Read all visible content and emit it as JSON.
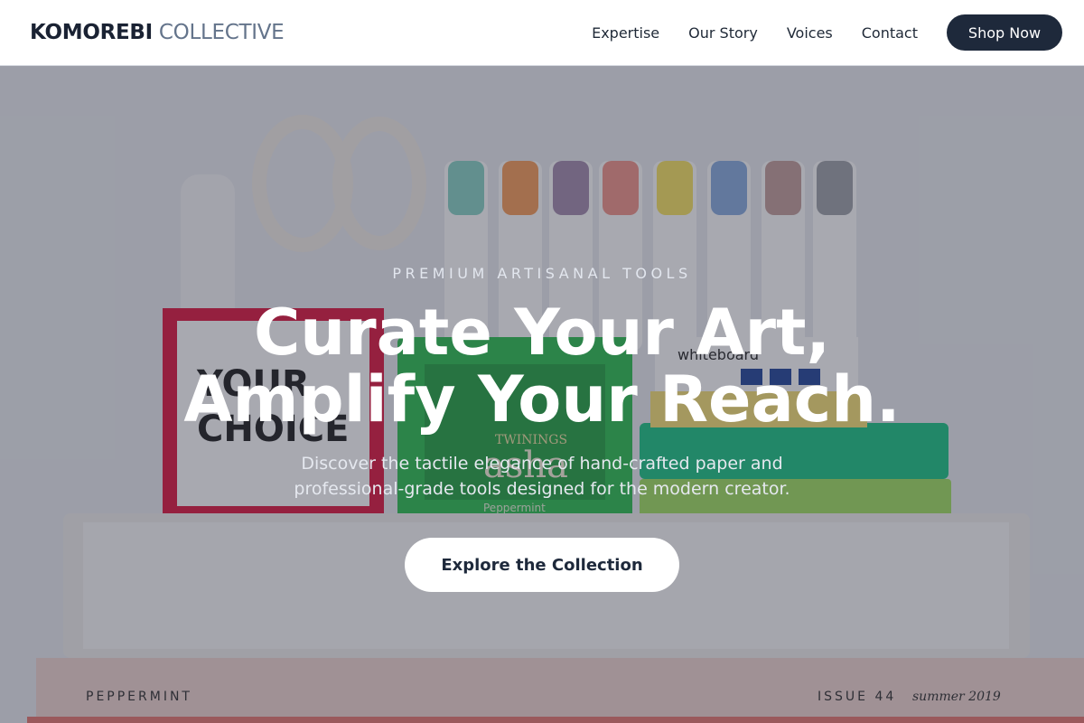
{
  "header": {
    "brand_strong": "KOMOREBI",
    "brand_light": "COLLECTIVE",
    "nav": [
      {
        "label": "Expertise"
      },
      {
        "label": "Our Story"
      },
      {
        "label": "Voices"
      },
      {
        "label": "Contact"
      }
    ],
    "shop_label": "Shop Now"
  },
  "hero": {
    "eyebrow": "PREMIUM ARTISANAL TOOLS",
    "headline_line1": "Curate Your Art,",
    "headline_line2": "Amplify Your Reach.",
    "subtext_line1": "Discover the tactile elegance of hand-crafted paper and",
    "subtext_line2": "professional-grade tools designed for the modern creator.",
    "cta_label": "Explore the Collection",
    "image_text": {
      "card": "YOUR CHOICE",
      "tea_brand": "TWININGS",
      "tea_name": "asha",
      "tea_flavor": "Peppermint",
      "board_label": "whiteboard",
      "book_left": "PEPPERMINT",
      "book_right": "ISSUE 44",
      "book_right_italic": "summer 2019"
    }
  },
  "colors": {
    "brand_dark": "#1e293b",
    "overlay": "#191e30"
  }
}
